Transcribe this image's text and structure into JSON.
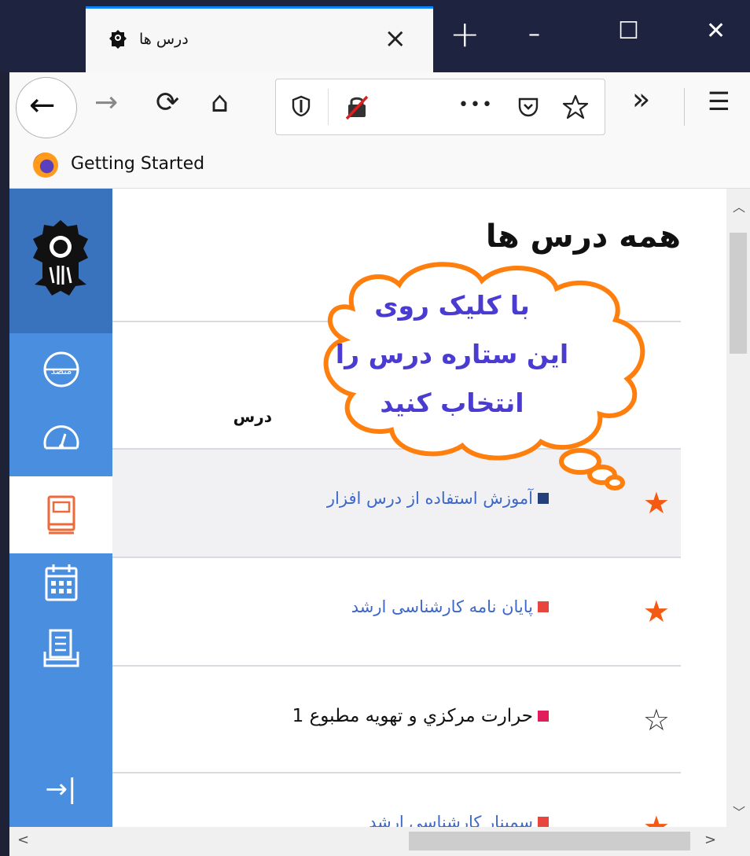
{
  "tab": {
    "title": "درس ها",
    "close_glyph": "×"
  },
  "window": {
    "new_tab_glyph": "+",
    "minimize_glyph": "–",
    "maximize_glyph": "☐",
    "close_glyph": "✕"
  },
  "nav": {
    "back_glyph": "←",
    "forward_glyph": "→",
    "reload_glyph": "⟳",
    "home_glyph": "⌂",
    "more_glyph": "•••",
    "overflow_glyph": "»",
    "menu_glyph": "☰"
  },
  "bookmarks": [
    {
      "label": "Getting Started"
    }
  ],
  "sidebar": {
    "items": [
      {
        "name": "dashboard",
        "icon": "dashboard-text-icon"
      },
      {
        "name": "speed",
        "icon": "speedometer-icon"
      },
      {
        "name": "courses",
        "icon": "book-icon",
        "active": true
      },
      {
        "name": "calendar",
        "icon": "calendar-icon"
      },
      {
        "name": "print",
        "icon": "printer-icon"
      }
    ],
    "collapse_glyph": "→|",
    "dashboard_label": "متصد"
  },
  "main": {
    "page_title": "همه درس ها",
    "column_header": "درس",
    "courses": [
      {
        "name": "آموزش استفاده از درس افزار",
        "color": "#24407c",
        "starred": true,
        "link": true
      },
      {
        "name": "پایان نامه کارشناسی ارشد",
        "color": "#e8453c",
        "starred": true,
        "link": true
      },
      {
        "name": "حرارت مرکزي و تهويه مطبوع 1",
        "color": "#e21d5c",
        "starred": false,
        "link": false
      },
      {
        "name": "سمینار کارشناسی ارشد",
        "color": "#e8453c",
        "starred": true,
        "link": true
      }
    ]
  },
  "callout": {
    "lines": [
      "با کلیک روی",
      "این ستاره درس را",
      "انتخاب کنید"
    ]
  },
  "colors": {
    "sidebar": "#4a8ee0",
    "sidebar_dark": "#3a73bd",
    "link": "#3d68c9",
    "star": "#f45a12",
    "callout_stroke": "#ff7f0e",
    "callout_text": "#4a3bd1"
  }
}
